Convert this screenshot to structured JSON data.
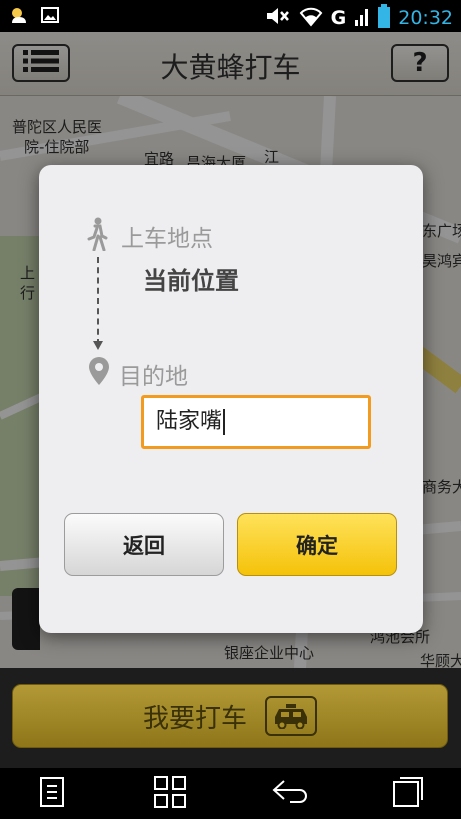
{
  "status_bar": {
    "network_label": "G",
    "time": "20:32",
    "left_icons": [
      "weather-icon",
      "gallery-icon"
    ],
    "right_icons": [
      "mute-icon",
      "wifi-icon",
      "signal-icon",
      "battery-icon"
    ]
  },
  "header": {
    "title": "大黄蜂打车",
    "help_label": "?"
  },
  "map": {
    "labels": {
      "putuo_hospital_1": "普陀区人民医",
      "putuo_hospital_2": "院-住院部",
      "road_1": "宜路",
      "road_2": "昌海大厦",
      "road_3": "江",
      "right_1": "东广场",
      "right_2": "昊鸿宾",
      "left_1": "上",
      "left_2": "行",
      "right_3": "商务大",
      "bottom_1": "鸿池会所",
      "bottom_2": "银座企业中心",
      "bottom_3": "华顾大"
    }
  },
  "dialog": {
    "pickup_label": "上车地点",
    "pickup_value": "当前位置",
    "destination_label": "目的地",
    "destination_value": "陆家嘴",
    "back_label": "返回",
    "confirm_label": "确定"
  },
  "bottom_bar": {
    "call_taxi_label": "我要打车"
  },
  "colors": {
    "accent_orange": "#f39b1f",
    "confirm_yellow": "#f4c20a",
    "clock_blue": "#33b5e5"
  }
}
